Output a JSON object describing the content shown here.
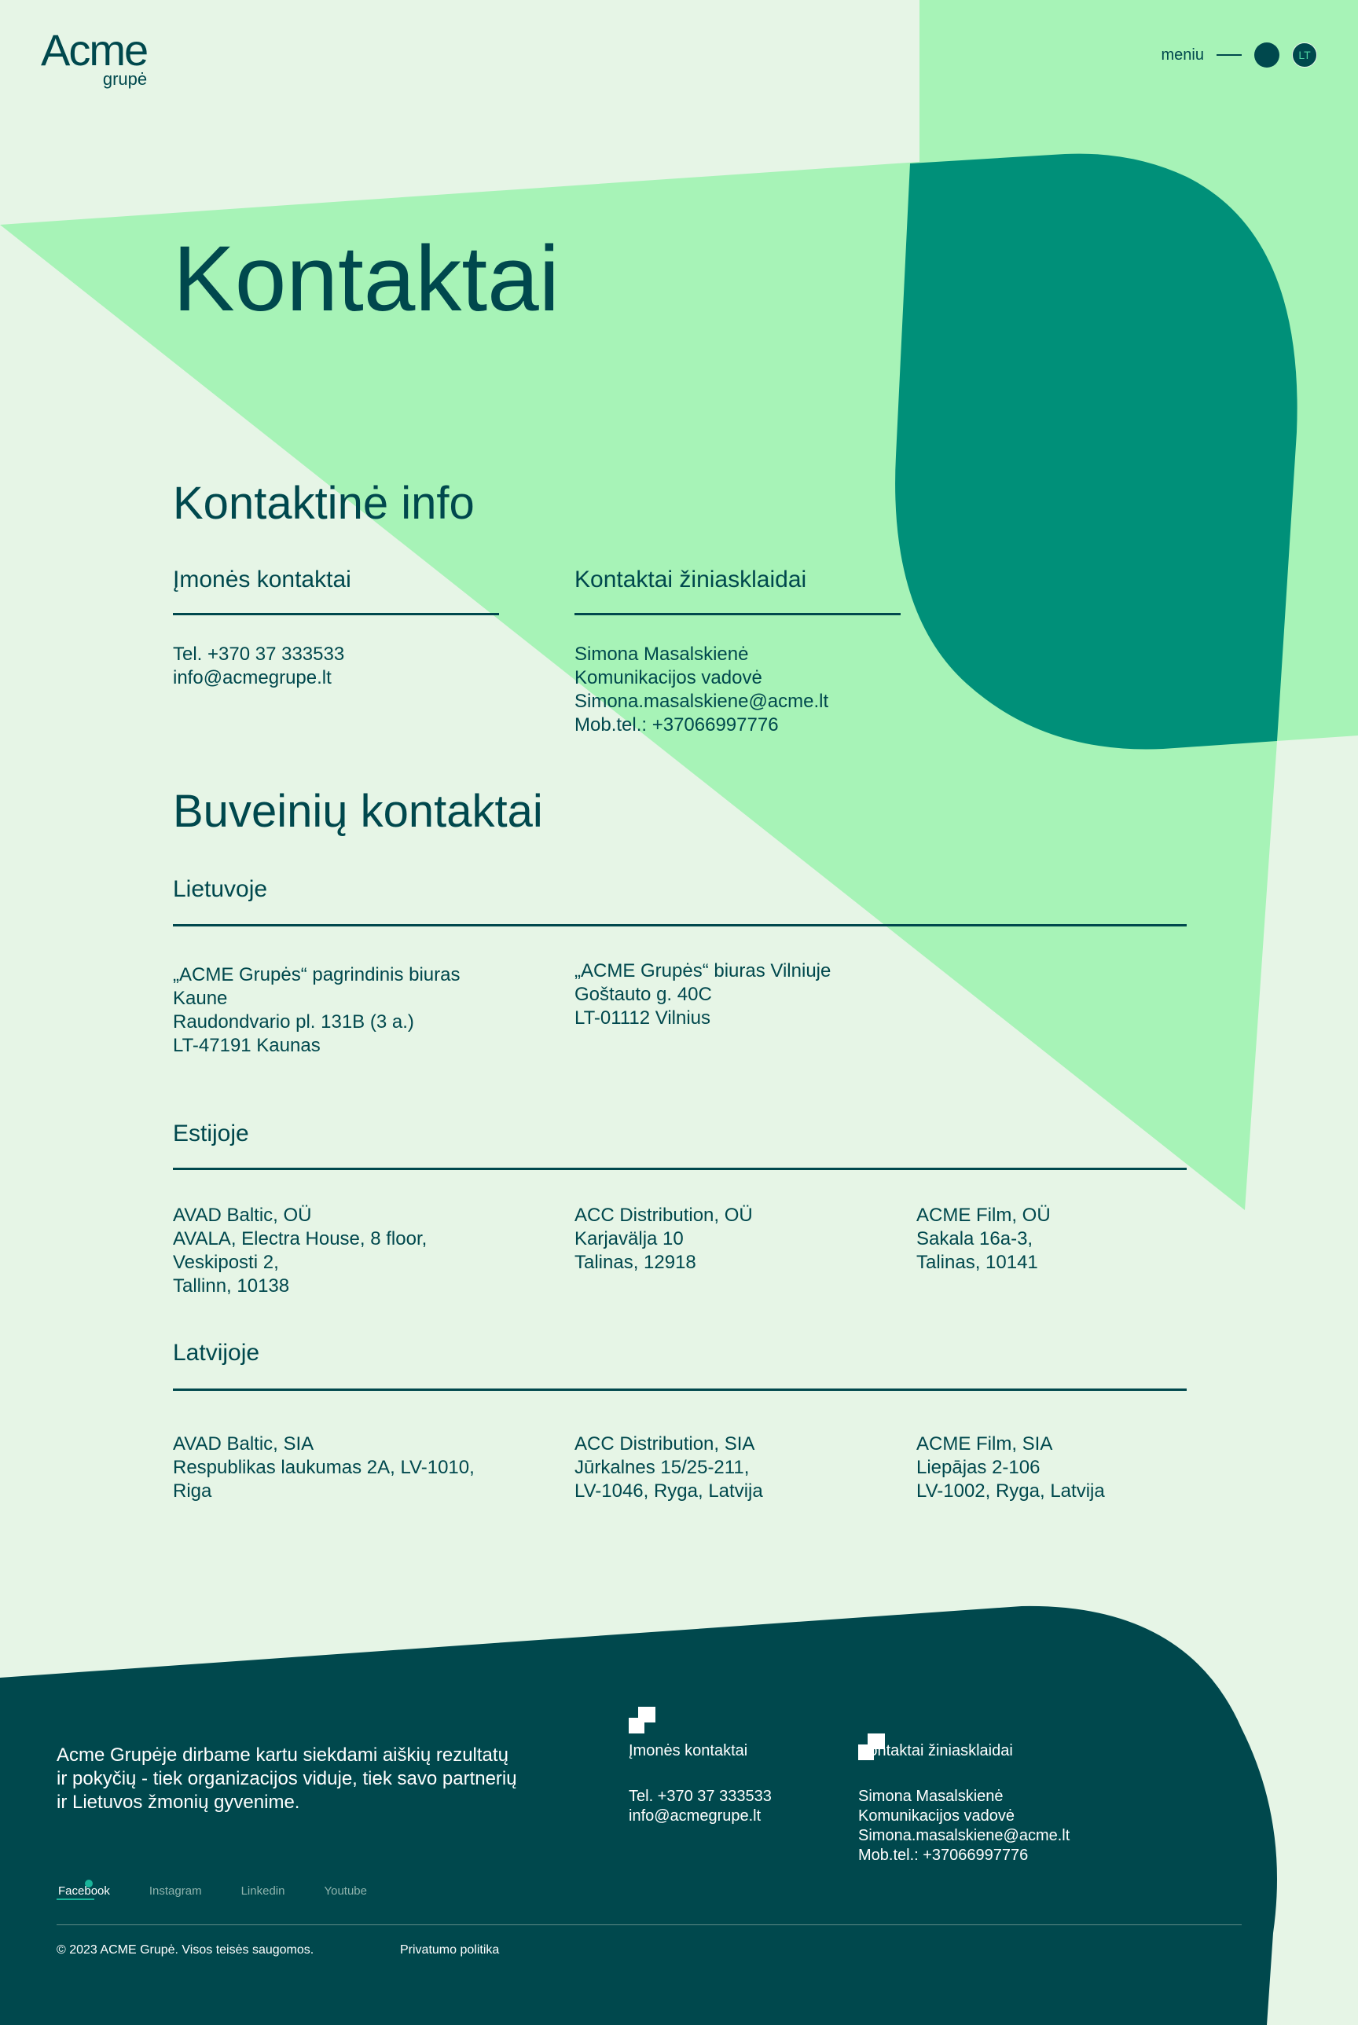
{
  "colors": {
    "page_bg": "#e6f5e6",
    "light_green": "#a7f3b7",
    "teal": "#009079",
    "dark": "#00484d",
    "text_dark": "#00484d",
    "footer_text": "#ffffff"
  },
  "header": {
    "logo": {
      "main": "Acme",
      "sub": "grupė"
    },
    "menu_label": "meniu",
    "lang": "LT"
  },
  "page_title": "Kontaktai",
  "contact_info": {
    "heading": "Kontaktinė info",
    "company": {
      "title": "Įmonės kontaktai",
      "lines": [
        "Tel. +370 37 333533",
        "info@acmegrupe.lt"
      ]
    },
    "media": {
      "title": "Kontaktai žiniasklaidai",
      "lines": [
        "Simona Masalskienė",
        "Komunikacijos vadovė",
        "Simona.masalskiene@acme.lt",
        "Mob.tel.: +37066997776"
      ]
    }
  },
  "offices": {
    "heading": "Buveinių kontaktai",
    "lithuania": {
      "title": "Lietuvoje",
      "items": [
        {
          "lines": [
            "„ACME Grupės“ pagrindinis biuras",
            "Kaune",
            "Raudondvario pl. 131B (3 a.)",
            "LT-47191 Kaunas"
          ]
        },
        {
          "lines": [
            "„ACME Grupės“ biuras Vilniuje",
            "Goštauto g. 40C",
            "LT-01112 Vilnius"
          ]
        }
      ]
    },
    "estonia": {
      "title": "Estijoje",
      "items": [
        {
          "lines": [
            "AVAD Baltic, OÜ",
            "AVALA, Electra House, 8 floor,",
            "Veskiposti 2,",
            "Tallinn, 10138"
          ]
        },
        {
          "lines": [
            "ACC Distribution, OÜ",
            "Karjavälja 10",
            "Talinas, 12918"
          ]
        },
        {
          "lines": [
            "ACME Film, OÜ",
            "Sakala 16a-3,",
            "Talinas, 10141"
          ]
        }
      ]
    },
    "latvia": {
      "title": "Latvijoje",
      "items": [
        {
          "lines": [
            "AVAD Baltic, SIA",
            "Respublikas laukumas 2A, LV-1010,",
            "Riga"
          ]
        },
        {
          "lines": [
            "ACC Distribution, SIA",
            "Jūrkalnes 15/25-211,",
            "LV-1046, Ryga, Latvija"
          ]
        },
        {
          "lines": [
            "ACME Film, SIA",
            "Liepājas 2-106",
            "LV-1002, Ryga, Latvija"
          ]
        }
      ]
    }
  },
  "footer": {
    "tagline_lines": [
      "Acme Grupėje dirbame kartu siekdami aiškių rezultatų",
      "ir pokyčių - tiek organizacijos viduje, tiek savo partnerių",
      "ir Lietuvos žmonių gyvenime."
    ],
    "company": {
      "title": "Įmonės kontaktai",
      "lines": [
        "Tel. +370 37 333533",
        "info@acmegrupe.lt"
      ]
    },
    "media": {
      "title": "Kontaktai žiniasklaidai",
      "lines": [
        "Simona Masalskienė",
        "Komunikacijos vadovė",
        "Simona.masalskiene@acme.lt",
        "Mob.tel.: +37066997776"
      ]
    },
    "social": [
      "Facebook",
      "Instagram",
      "Linkedin",
      "Youtube"
    ],
    "copyright": "© 2023 ACME Grupė. Visos teisės saugomos.",
    "privacy": "Privatumo politika"
  }
}
